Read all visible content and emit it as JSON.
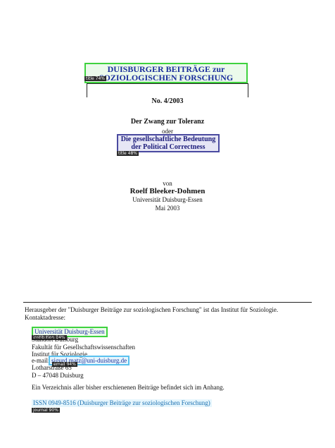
{
  "series_title": "DUISBURGER BEITRÄGE zur SOZIOLOGISCHEN FORSCHUNG",
  "series_tag": "title 74%",
  "issue_number": "No. 4/2003",
  "title": "Der Zwang zur Toleranz",
  "connector": "oder",
  "subtitle": "Die gesellschaftliche Bedeutung der Political Correctness",
  "subtitle_tag": "title 48%",
  "von": "von",
  "author": "Roelf Bleeker-Dohmen",
  "affiliation": "Universität Duisburg-Essen",
  "date": "Mai 2003",
  "publisher_text": "Herausgeber der \"Duisburger Beiträge zur soziologischen Forschung\" ist das Institut für Soziologie. Kontaktadresse:",
  "contact": {
    "university": "Universität Duisburg-Essen",
    "university_tag": "institution 84%",
    "campus": "Standort Duisburg",
    "faculty": "Fakultät für Gesellschaftswissenschaften",
    "institute": "Institut für Soziologie",
    "email_prefix": "e-mail: ",
    "email": "sigurd.matz@uni-duisburg.de",
    "email_tag": "email 94%",
    "street": "Lotharstraße 65",
    "city": "D – 47048 Duisburg"
  },
  "appendix_note": "Ein Verzeichnis aller bisher erschienenen Beiträge befindet sich im Anhang.",
  "issn_text": "ISSN 0949-8516 (Duisburger Beiträge zur soziologischen Forschung)",
  "issn_tag": "journal 90%"
}
